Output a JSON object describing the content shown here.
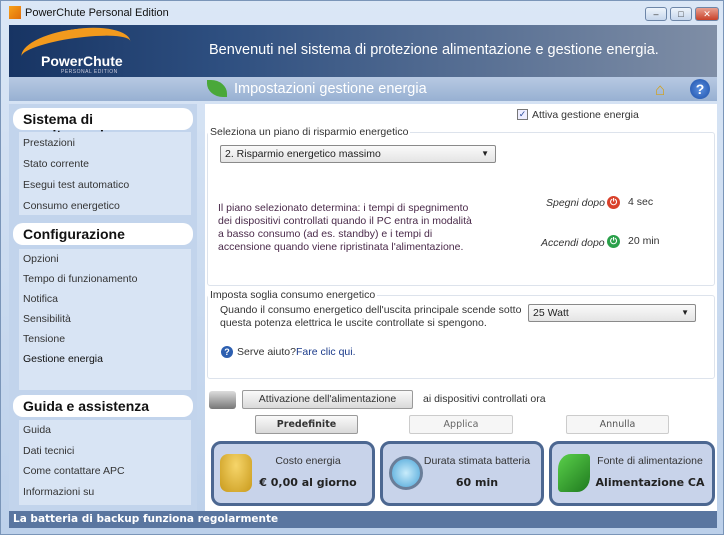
{
  "window": {
    "title": "PowerChute Personal Edition",
    "minimize": "–",
    "maximize": "□",
    "close": "✕"
  },
  "banner": {
    "logo": "PowerChute",
    "logo_sub": "PERSONAL EDITION",
    "welcome": "Benvenuti nel sistema di protezione alimentazione e gestione energia."
  },
  "subheader": {
    "title": "Impostazioni gestione energia",
    "home_icon": "⌂",
    "help_icon": "?"
  },
  "sidebar": {
    "sections": [
      {
        "title": "Sistema di monitoraggio",
        "items": [
          "Prestazioni",
          "Stato corrente",
          "Esegui test automatico",
          "Consumo energetico"
        ]
      },
      {
        "title": "Configurazione",
        "items": [
          "Opzioni",
          "Tempo di funzionamento",
          "Notifica",
          "Sensibilità",
          "Tensione",
          "Gestione energia"
        ]
      },
      {
        "title": "Guida e assistenza",
        "items": [
          "Guida",
          "Dati tecnici",
          "Come contattare APC",
          "Informazioni su"
        ]
      }
    ],
    "active_item": "Gestione energia"
  },
  "main": {
    "enable_checkbox": {
      "label": "Attiva gestione energia",
      "checked": true,
      "mark": "✓"
    },
    "plan": {
      "legend": "Seleziona un piano di risparmio energetico",
      "selected": "2. Risparmio energetico massimo",
      "description": [
        "Il piano selezionato determina: i tempi di spegnimento",
        "dei dispositivi controllati quando il PC entra in modalità",
        "a basso consumo (ad es. standby) e i tempi di",
        "accensione quando viene ripristinata l'alimentazione."
      ],
      "off_label": "Spegni dopo",
      "off_value": "4 sec",
      "on_label": "Accendi dopo",
      "on_value": "20 min",
      "off_color": "#d9412b",
      "on_color": "#2aa04a"
    },
    "threshold": {
      "legend": "Imposta soglia consumo energetico",
      "text": [
        "Quando il consumo energetico dell'uscita principale scende sotto",
        "questa potenza elettrica le uscite controllate si spengono."
      ],
      "selected": "25 Watt"
    },
    "help": {
      "question": "Serve aiuto?",
      "link": "Fare clic qui."
    },
    "power_on": {
      "button": "Attivazione dell'alimentazione",
      "suffix": "ai dispositivi controllati ora"
    },
    "buttons": {
      "defaults": "Predefinite",
      "apply": "Applica",
      "cancel": "Annulla"
    },
    "cards": [
      {
        "label": "Costo energia",
        "value": "€ 0,00 al giorno",
        "icon": "coins-icon"
      },
      {
        "label": "Durata stimata batteria",
        "value": "60 min",
        "icon": "clock-icon"
      },
      {
        "label": "Fonte di alimentazione",
        "value": "Alimentazione CA",
        "icon": "plug-icon"
      }
    ]
  },
  "status": "La batteria di backup funziona regolarmente"
}
